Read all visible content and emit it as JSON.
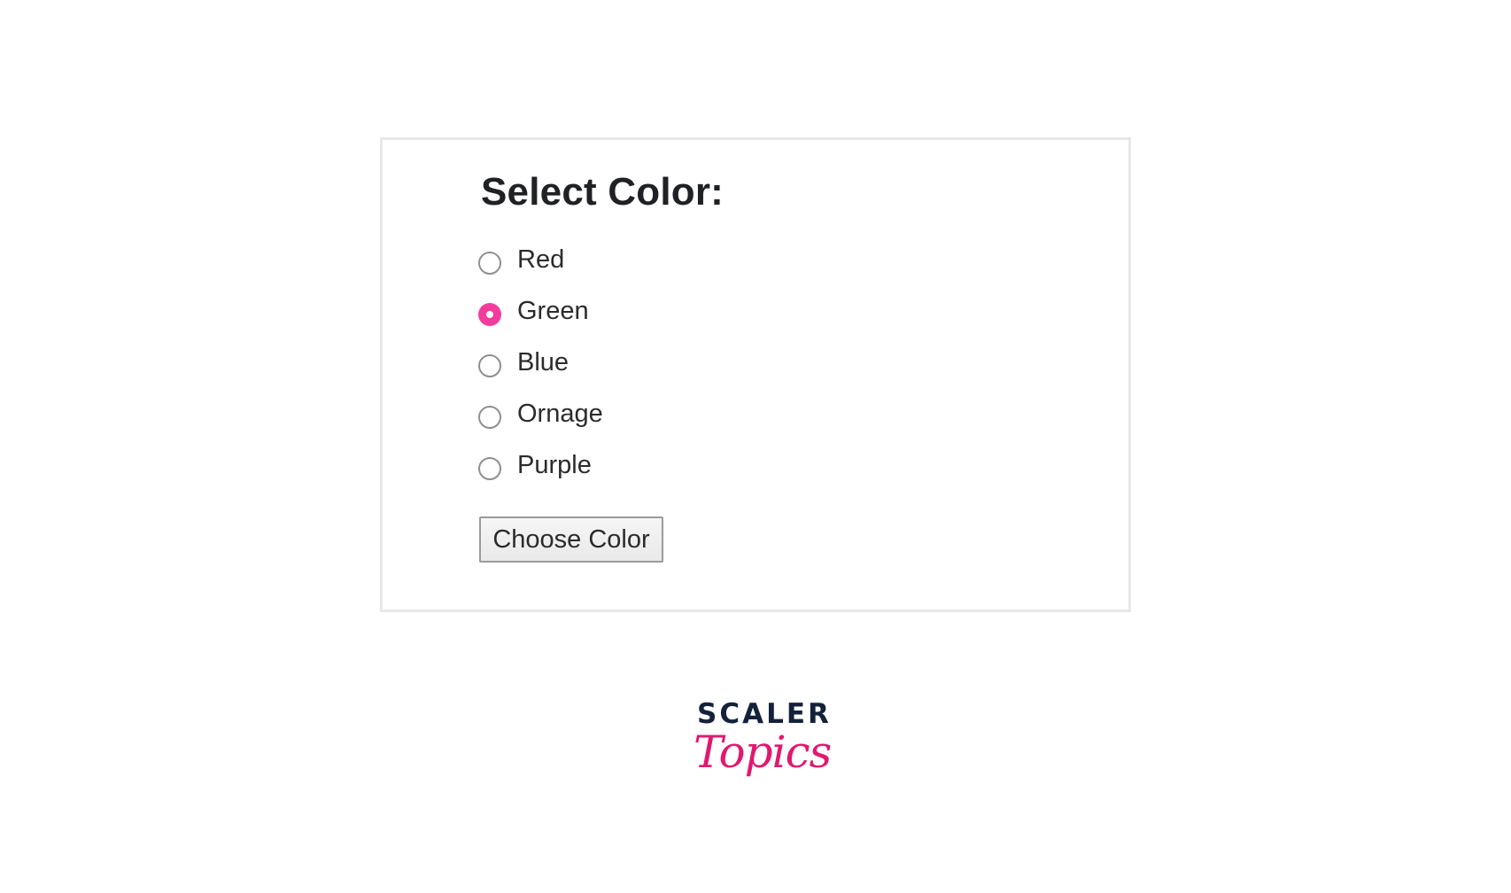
{
  "form": {
    "heading": "Select Color:",
    "options": [
      {
        "label": "Red",
        "checked": false
      },
      {
        "label": "Green",
        "checked": true
      },
      {
        "label": "Blue",
        "checked": false
      },
      {
        "label": "Ornage",
        "checked": false
      },
      {
        "label": "Purple",
        "checked": false
      }
    ],
    "button_label": "Choose Color"
  },
  "logo": {
    "top_text": "SCALER",
    "bottom_text": "Topics"
  },
  "colors": {
    "accent": "#f23d9e",
    "brand_pink": "#e0196f",
    "brand_navy": "#14213a",
    "card_border": "#e8e8e8"
  }
}
